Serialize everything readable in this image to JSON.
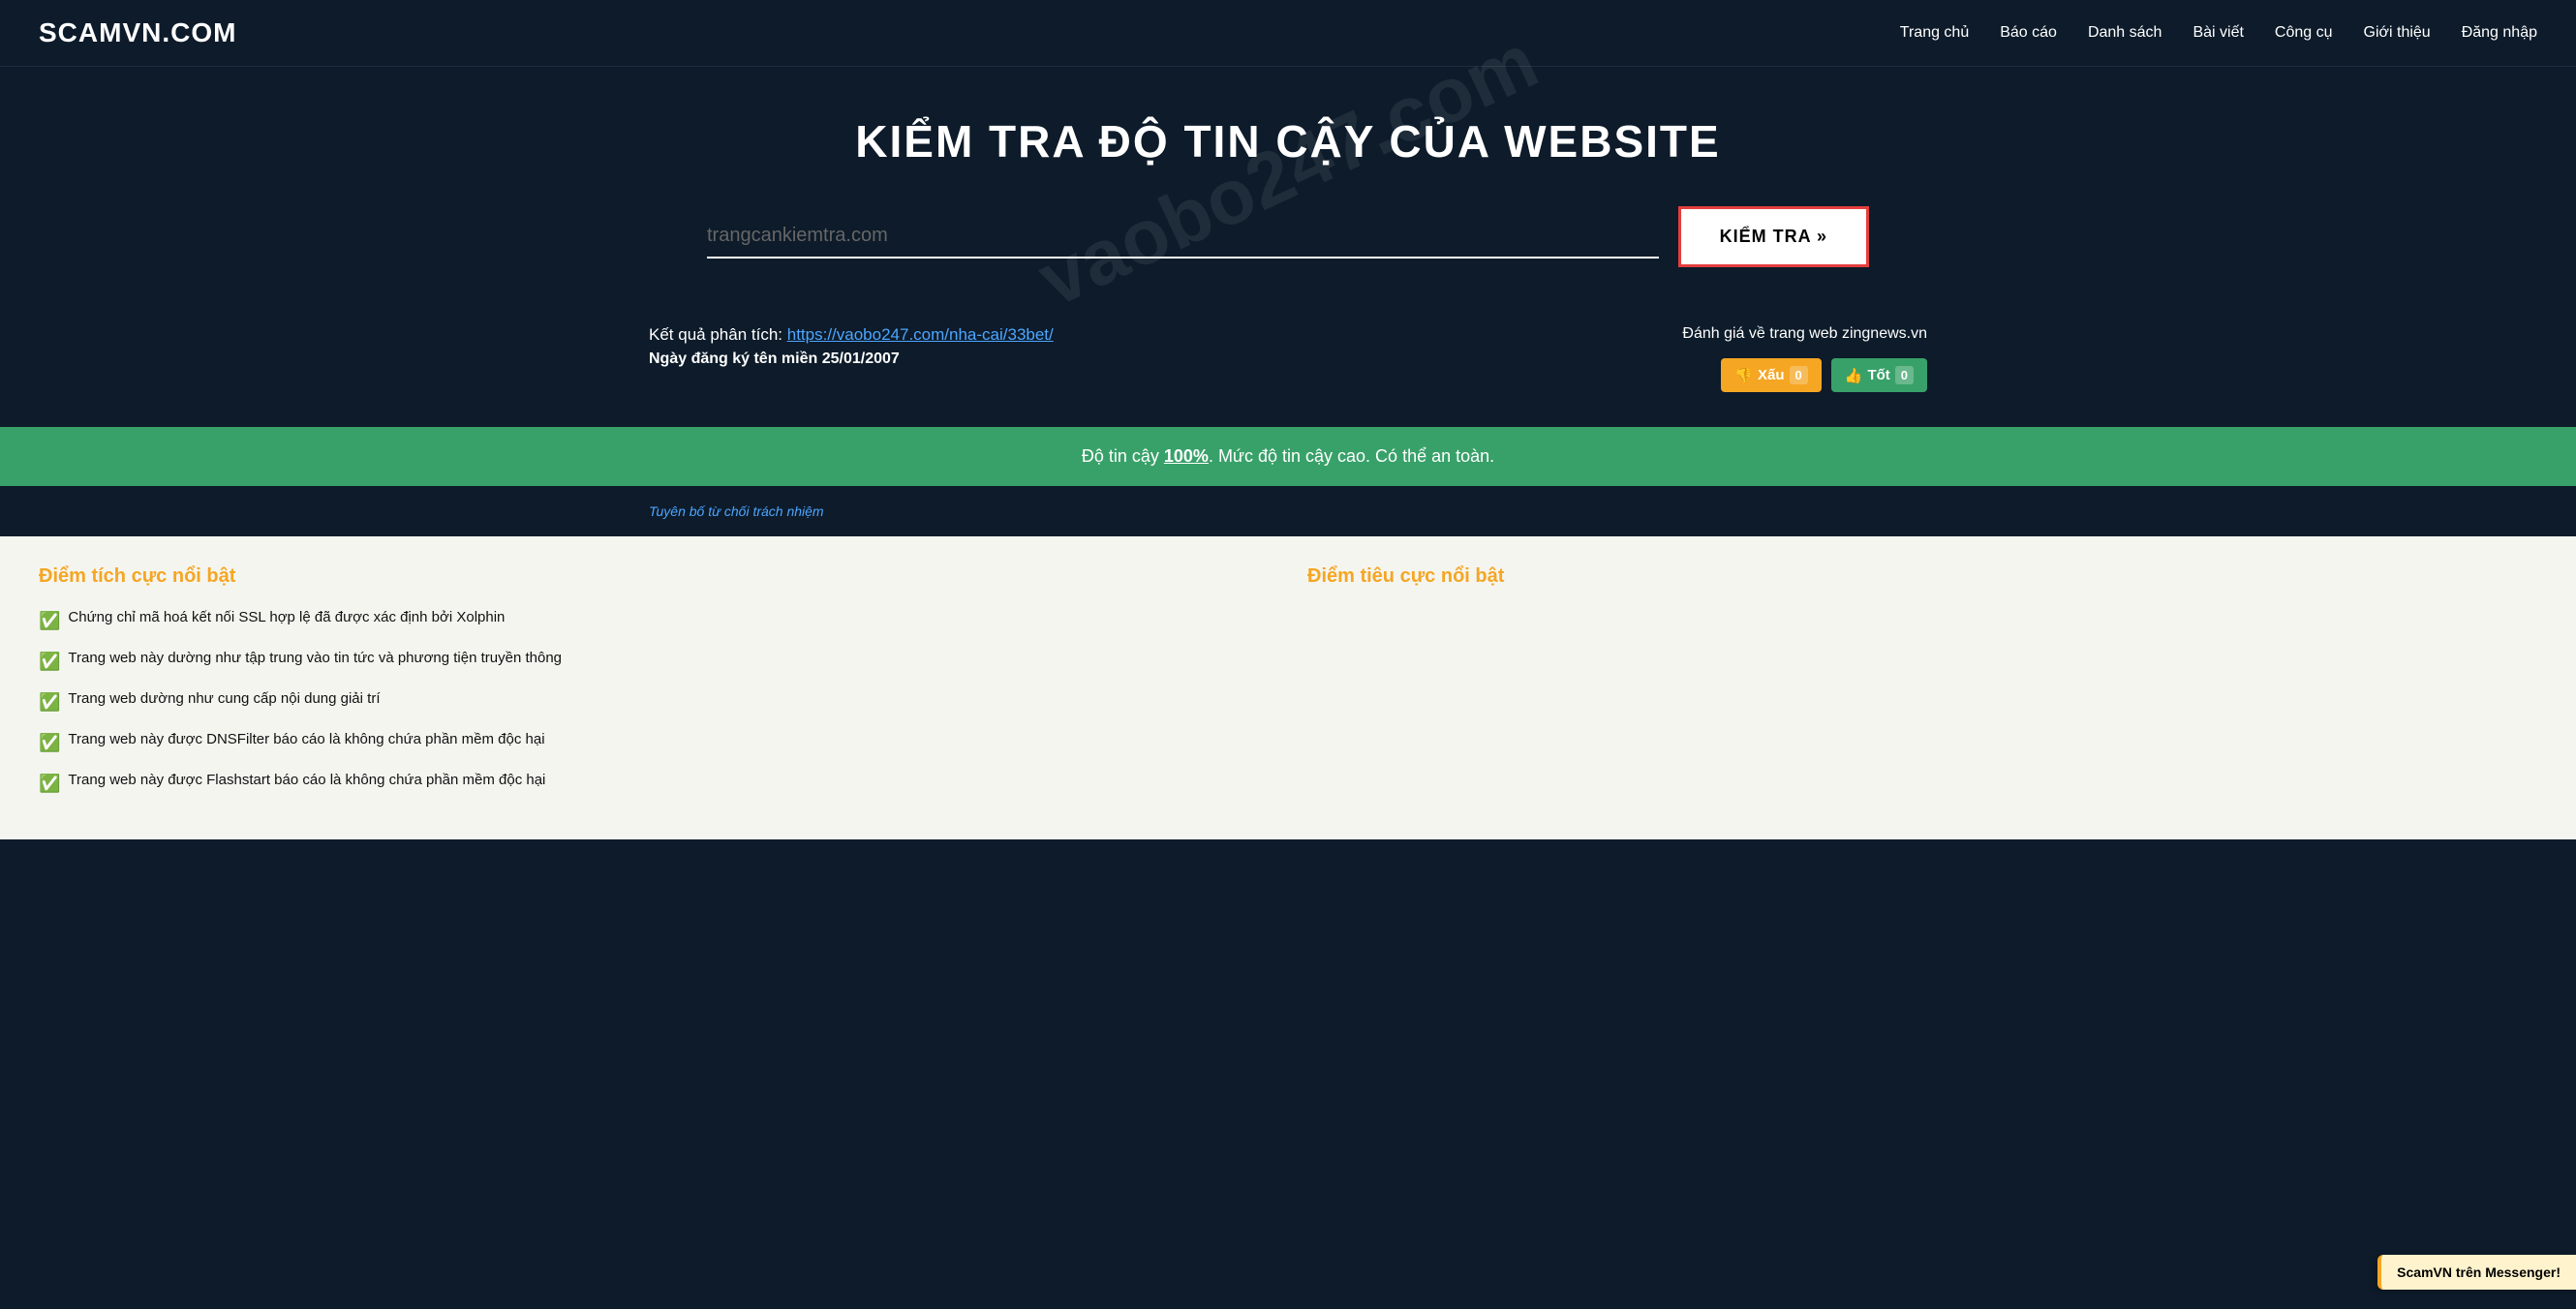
{
  "header": {
    "logo": "SCAMVN.COM",
    "nav": [
      {
        "label": "Trang chủ",
        "href": "#"
      },
      {
        "label": "Báo cáo",
        "href": "#"
      },
      {
        "label": "Danh sách",
        "href": "#"
      },
      {
        "label": "Bài viết",
        "href": "#"
      },
      {
        "label": "Công cụ",
        "href": "#"
      },
      {
        "label": "Giới thiệu",
        "href": "#"
      },
      {
        "label": "Đăng nhập",
        "href": "#"
      }
    ]
  },
  "hero": {
    "title": "KIỂM TRA ĐỘ TIN CẬY CỦA WEBSITE",
    "search_placeholder": "trangcankiemtra.com",
    "search_value": "",
    "button_label": "KIỂM TRA »",
    "watermark": "vaobo247.com"
  },
  "results": {
    "label": "Kết quả phân tích:",
    "link_text": "https://vaobo247.com/nha-cai/33bet/",
    "link_href": "https://vaobo247.com/nha-cai/33bet/",
    "date_label": "Ngày đăng ký tên miền 25/01/2007",
    "rating_label": "Đánh giá về trang web zingnews.vn",
    "btn_xau": "👎 Xấu",
    "btn_xau_count": "0",
    "btn_tot": "👍 Tốt",
    "btn_tot_count": "0"
  },
  "trust_bar": {
    "text_before": "Độ tin cậy ",
    "percent": "100%",
    "text_after": ". Mức độ tin cậy cao. Có thể an toàn."
  },
  "disclaimer": {
    "link_text": "Tuyên bố từ chối trách nhiệm"
  },
  "analysis": {
    "positive_title": "Điểm tích cực nổi bật",
    "negative_title": "Điểm tiêu cực nổi bật",
    "positive_items": [
      "Chứng chỉ mã hoá kết nối SSL hợp lệ đã được xác định bởi Xolphin",
      "Trang web này dường như tập trung vào tin tức và phương tiện truyền thông",
      "Trang web dường như cung cấp nội dung giải trí",
      "Trang web này được DNSFilter báo cáo là không chứa phần mềm độc hại",
      "Trang web này được Flashstart báo cáo là không chứa phần mềm độc hại"
    ],
    "negative_items": []
  },
  "messenger_badge": {
    "text": "ScamVN trên Messenger!"
  }
}
